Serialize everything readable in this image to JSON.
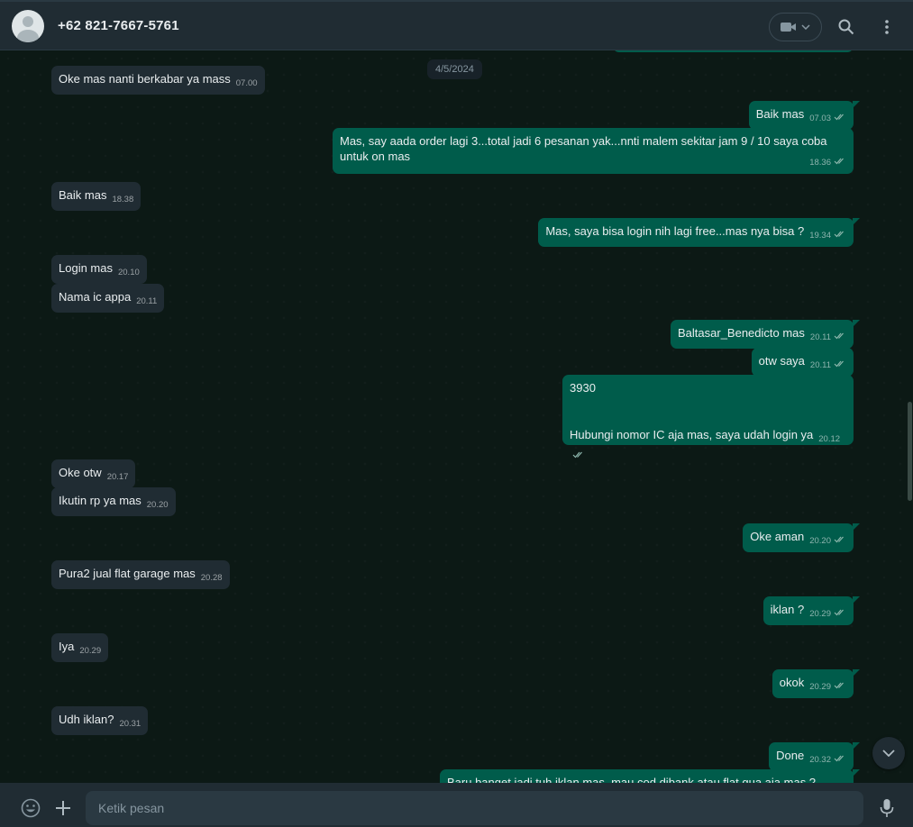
{
  "header": {
    "contact_name": "+62 821-7667-5761",
    "avatar_icon": "default-avatar-icon",
    "video_icon": "video-camera-icon",
    "search_icon": "search-icon",
    "menu_icon": "more-vertical-icon"
  },
  "chat": {
    "date_chip": "4/5/2024",
    "messages": [
      {
        "dir": "in",
        "text": "Oke mas nanti berkabar ya mass",
        "time": "07.00"
      },
      {
        "dir": "out",
        "text": "Baik mas",
        "time": "07.03"
      },
      {
        "dir": "out",
        "text": "Mas, say aada order lagi 3...total jadi 6 pesanan yak...nnti malem sekitar jam 9 / 10 saya coba untuk on mas",
        "time": "18.36"
      },
      {
        "dir": "in",
        "text": "Baik mas",
        "time": "18.38"
      },
      {
        "dir": "out",
        "text": "Mas, saya bisa login nih lagi free...mas nya bisa ?",
        "time": "19.34"
      },
      {
        "dir": "in",
        "text": "Login mas",
        "time": "20.10"
      },
      {
        "dir": "in",
        "text": "Nama ic appa",
        "time": "20.11"
      },
      {
        "dir": "out",
        "text": "Baltasar_Benedicto mas",
        "time": "20.11"
      },
      {
        "dir": "out",
        "text": "otw saya",
        "time": "20.11"
      },
      {
        "dir": "out",
        "text_line1": "3930",
        "text_line2": "Hubungi nomor IC aja mas, saya udah login ya",
        "time": "20.12"
      },
      {
        "dir": "in",
        "text": "Oke otw",
        "time": "20.17"
      },
      {
        "dir": "in",
        "text": "Ikutin rp ya mas",
        "time": "20.20"
      },
      {
        "dir": "out",
        "text": "Oke aman",
        "time": "20.20"
      },
      {
        "dir": "in",
        "text": "Pura2 jual flat garage mas",
        "time": "20.28"
      },
      {
        "dir": "out",
        "text": "iklan ?",
        "time": "20.29"
      },
      {
        "dir": "in",
        "text": "Iya",
        "time": "20.29"
      },
      {
        "dir": "out",
        "text": "okok",
        "time": "20.29"
      },
      {
        "dir": "in",
        "text": "Udh iklan?",
        "time": "20.31"
      },
      {
        "dir": "out",
        "text": "Done",
        "time": "20.32"
      },
      {
        "dir": "out",
        "text": "Baru banget jadi tuh iklan mas, mau cod dibank atau flat gua aja mas ?",
        "time": ""
      }
    ]
  },
  "footer": {
    "placeholder": "Ketik pesan",
    "emoji_icon": "emoji-icon",
    "attach_icon": "plus-icon",
    "mic_icon": "microphone-icon"
  },
  "colors": {
    "outgoing_bubble": "#005c4b",
    "incoming_bubble": "#202c33",
    "chat_bg": "#0c1915",
    "header_bg": "#202c33"
  }
}
